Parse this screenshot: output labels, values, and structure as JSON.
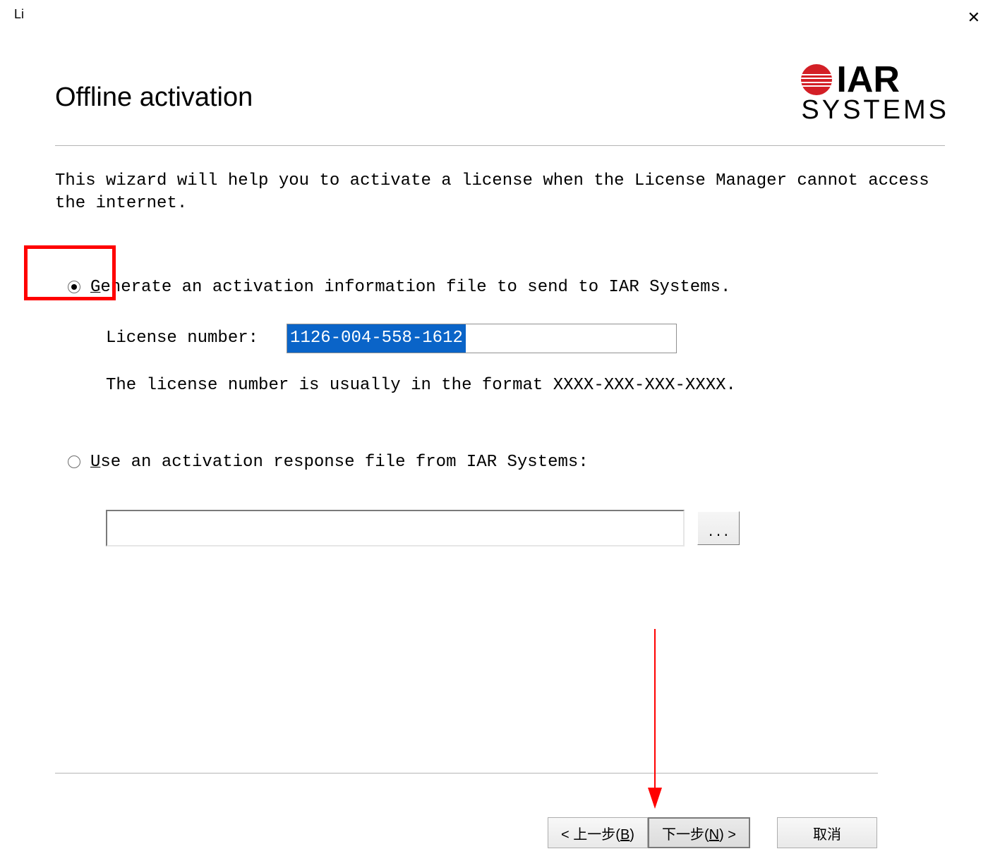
{
  "window": {
    "title_prefix": "Li"
  },
  "header": {
    "title": "Offline activation"
  },
  "logo": {
    "iar": "IAR",
    "systems": "SYSTEMS"
  },
  "intro": "This wizard will help you to activate a license when the License Manager cannot access the internet.",
  "option_generate": {
    "prefix": "G",
    "rest": "enerate an activation information file to send to IAR Systems.",
    "license_label": "License number:",
    "license_value": "1126-004-558-1612",
    "format_hint": "The license number is usually in the format XXXX-XXX-XXX-XXXX."
  },
  "option_use": {
    "prefix": "U",
    "rest": "se an activation response file from IAR Systems:",
    "file_path": "",
    "browse_label": "..."
  },
  "buttons": {
    "back_full": "< 上一步(B)",
    "next_full": "下一步(N) >",
    "cancel": "取消"
  }
}
